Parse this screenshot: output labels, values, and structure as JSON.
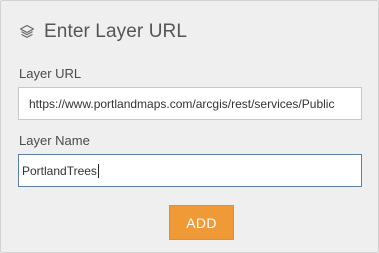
{
  "header": {
    "title": "Enter Layer URL",
    "icon": "layers-icon"
  },
  "layer_url": {
    "label": "Layer URL",
    "value": "https://www.portlandmaps.com/arcgis/rest/services/Public"
  },
  "layer_name": {
    "label": "Layer Name",
    "value": "PortlandTrees"
  },
  "actions": {
    "add_label": "ADD"
  },
  "colors": {
    "panel_bg": "#efefef",
    "accent": "#f09a37",
    "focus_border": "#5d7fa5"
  }
}
